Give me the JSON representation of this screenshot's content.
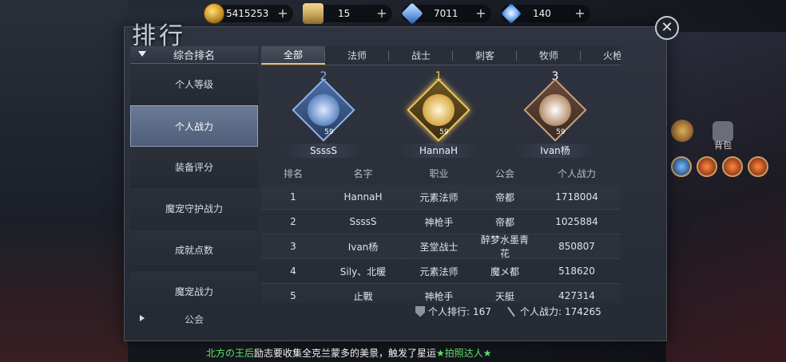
{
  "resources": [
    {
      "icon": "gold-coin-icon",
      "value": "5415253"
    },
    {
      "icon": "scroll-icon",
      "value": "15"
    },
    {
      "icon": "blue-crystal-icon",
      "value": "7011"
    },
    {
      "icon": "diamond-icon",
      "value": "140"
    }
  ],
  "resource_plus": "+",
  "page_title": "排行",
  "close_label": "✕",
  "sidebar": {
    "header": "综合排名",
    "items": [
      "个人等级",
      "个人战力",
      "装备评分",
      "魔宠守护战力",
      "成就点数",
      "魔宠战力"
    ],
    "active_index": 1,
    "last_item": "公会"
  },
  "tabs": [
    "全部",
    "法师",
    "战士",
    "刺客",
    "牧师",
    "火枪"
  ],
  "active_tab": 0,
  "podium": [
    {
      "rank": "2",
      "name": "SsssS",
      "level": "59"
    },
    {
      "rank": "1",
      "name": "HannaH",
      "level": "59"
    },
    {
      "rank": "3",
      "name": "Ivan杨",
      "level": "59"
    }
  ],
  "table": {
    "headers": [
      "排名",
      "名字",
      "职业",
      "公会",
      "个人战力"
    ],
    "rows": [
      [
        "1",
        "HannaH",
        "元素法师",
        "帝都",
        "1718004"
      ],
      [
        "2",
        "SsssS",
        "神枪手",
        "帝都",
        "1025884"
      ],
      [
        "3",
        "Ivan杨",
        "圣堂战士",
        "醉梦水墨青花",
        "850807"
      ],
      [
        "4",
        "Sily、北暖",
        "元素法师",
        "魔メ都",
        "518620"
      ],
      [
        "5",
        "止戰",
        "神枪手",
        "天艇",
        "427314"
      ]
    ]
  },
  "footer": {
    "my_rank_label": "个人排行:",
    "my_rank_value": "167",
    "my_power_label": "个人战力:",
    "my_power_value": "174265"
  },
  "notice": {
    "part1": "北方の王后",
    "part2": "励志要收集全克兰蒙多的美景，触发了星运",
    "part3": "★拍照达人★"
  },
  "right_deco": {
    "bag_label": "背包"
  }
}
